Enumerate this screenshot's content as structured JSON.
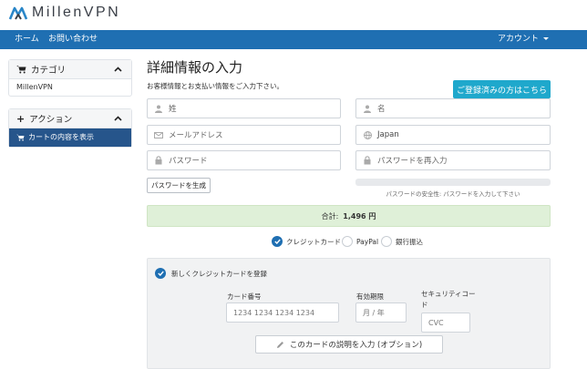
{
  "brand": {
    "name": "MillenVPN"
  },
  "nav": {
    "home": "ホーム",
    "contact": "お問い合わせ",
    "account": "アカウント"
  },
  "sidebar": {
    "categories": {
      "title": "カテゴリ",
      "items": [
        "MillenVPN"
      ]
    },
    "actions": {
      "title": "アクション",
      "items": [
        "カートの内容を表示"
      ]
    }
  },
  "main": {
    "title": "詳細情報の入力",
    "subtitle": "お客様情報とお支払い情報をご入力下さい。",
    "login_button": "ご登録済みの方はこちら",
    "fields": {
      "last_name": "姓",
      "first_name": "名",
      "email": "メールアドレス",
      "country": "Japan",
      "password": "パスワード",
      "password_confirm": "パスワードを再入力"
    },
    "generate_password": "パスワードを生成",
    "strength_text": "パスワードの安全性: パスワードを入力して下さい",
    "total_label": "合計:",
    "total_value": "1,496 円",
    "payment_methods": [
      {
        "label": "クレジットカード",
        "selected": true
      },
      {
        "label": "PayPal",
        "selected": false
      },
      {
        "label": "銀行振込",
        "selected": false
      }
    ],
    "card": {
      "new_card_label": "新しくクレジットカードを登録",
      "card_number_label": "カード番号",
      "card_number_placeholder": "1234 1234 1234 1234",
      "expiry_label": "有効期限",
      "expiry_placeholder": "月 / 年",
      "cvc_label": "セキュリティコード",
      "cvc_placeholder": "CVC",
      "description_button": "このカードの説明を入力 (オプション)"
    }
  },
  "colors": {
    "navbar": "#1f6fb2",
    "accent_button": "#1fa8cc",
    "sidebar_active": "#26558b",
    "total_bg": "#dff0d8"
  }
}
